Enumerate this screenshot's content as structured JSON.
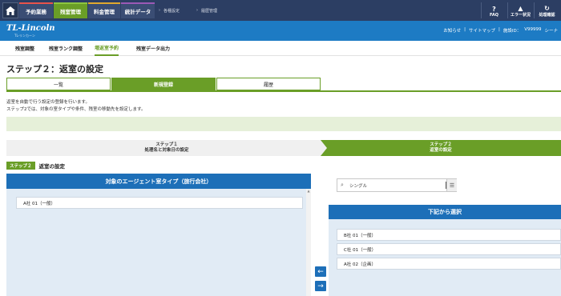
{
  "topnav": {
    "tabs": [
      "予約業務",
      "残室管理",
      "料金管理",
      "統計データ"
    ],
    "breadcrumbs": [
      "各種設定",
      "履歴管理"
    ],
    "buttons": [
      {
        "label": "FAQ",
        "icon": "question-icon"
      },
      {
        "label": "エラー状況",
        "icon": "warning-icon"
      },
      {
        "label": "処理確認",
        "icon": "refresh-icon"
      }
    ]
  },
  "brand": {
    "logo": "TL-Lincoln",
    "logo_sub": "TL-リンカーン",
    "links": [
      "お知らせ",
      "サイトマップ",
      "施設ID：",
      "V99999",
      "シーナ"
    ]
  },
  "subnav": [
    "残室調整",
    "残室ランク調整",
    "増返室予約",
    "残室データ出力"
  ],
  "page_title": "ステップ２：返室の設定",
  "tabs": [
    "一覧",
    "新規登録",
    "履歴"
  ],
  "desc": {
    "line1": "返室を自動で行う設定の登録を行います。",
    "line2": "ステップ2では、対象の室タイプや条件、残室の移動先を設定します。"
  },
  "steps": {
    "step1_num": "ステップ１",
    "step1_label": "処理名と対象日の設定",
    "step2_num": "ステップ２",
    "step2_label": "返室の設定"
  },
  "step_header": {
    "badge": "ステップ２",
    "label": "返室の設定"
  },
  "left_panel": {
    "title": "対象のエージェント室タイプ（旅行会社）",
    "items": [
      "A社 01（一般）"
    ]
  },
  "search": {
    "value": "シングル"
  },
  "right_panel": {
    "title": "下記から選択",
    "items": [
      "B社 01（一般）",
      "C社 01（一般）",
      "A社 02（企画）"
    ]
  },
  "colors": {
    "nav": "#2c3e63",
    "brand": "#1d7bc4",
    "accent_green": "#6a9e27",
    "panel_blue": "#1d6fb8"
  }
}
